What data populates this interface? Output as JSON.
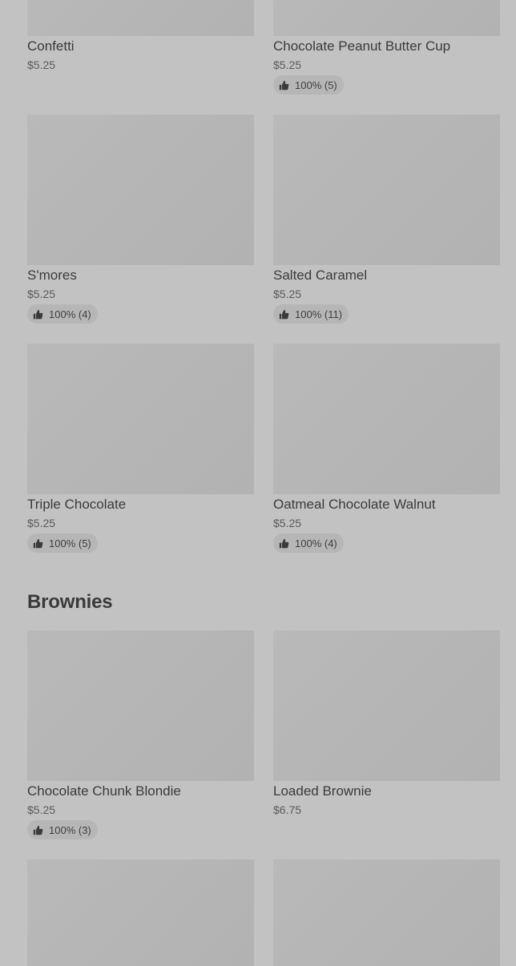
{
  "sections": [
    {
      "items": [
        {
          "name": "Confetti",
          "price": "$5.25",
          "rating": ""
        },
        {
          "name": "Chocolate Peanut Butter Cup",
          "price": "$5.25",
          "rating": "100% (5)"
        },
        {
          "name": "S'mores",
          "price": "$5.25",
          "rating": "100% (4)"
        },
        {
          "name": "Salted Caramel",
          "price": "$5.25",
          "rating": "100% (11)"
        },
        {
          "name": "Triple Chocolate",
          "price": "$5.25",
          "rating": "100% (5)"
        },
        {
          "name": "Oatmeal Chocolate Walnut",
          "price": "$5.25",
          "rating": "100% (4)"
        }
      ]
    },
    {
      "title": "Brownies",
      "items": [
        {
          "name": "Chocolate Chunk Blondie",
          "price": "$5.25",
          "rating": "100% (3)"
        },
        {
          "name": "Loaded Brownie",
          "price": "$6.75",
          "rating": ""
        },
        {
          "name": "",
          "price": "",
          "rating": ""
        },
        {
          "name": "",
          "price": "",
          "rating": ""
        }
      ]
    }
  ],
  "icons": {
    "rating": "thumbs-up-icon"
  },
  "colors": {
    "background": "#c2c2c2",
    "image_placeholder": "#b6b6b6",
    "rating_pill": "#b6b6b6"
  }
}
